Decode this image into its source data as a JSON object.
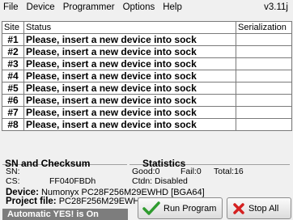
{
  "menu": {
    "items": [
      "File",
      "Device",
      "Programmer",
      "Options",
      "Help"
    ],
    "version": "v3.11j"
  },
  "table": {
    "headers": {
      "site": "Site",
      "status": "Status",
      "serialization": "Serialization"
    },
    "rows": [
      {
        "site": "#1",
        "status": "Please, insert a new device into sock",
        "serial": ""
      },
      {
        "site": "#2",
        "status": "Please, insert a new device into sock",
        "serial": ""
      },
      {
        "site": "#3",
        "status": "Please, insert a new device into sock",
        "serial": ""
      },
      {
        "site": "#4",
        "status": "Please, insert a new device into sock",
        "serial": ""
      },
      {
        "site": "#5",
        "status": "Please, insert a new device into sock",
        "serial": ""
      },
      {
        "site": "#6",
        "status": "Please, insert a new device into sock",
        "serial": ""
      },
      {
        "site": "#7",
        "status": "Please, insert a new device into sock",
        "serial": ""
      },
      {
        "site": "#8",
        "status": "Please, insert a new device into sock",
        "serial": ""
      }
    ]
  },
  "sn_checksum": {
    "title": "SN and Checksum",
    "sn_label": "SN:",
    "cs_label": "CS:",
    "cs_value": "FF040FBDh"
  },
  "statistics": {
    "title": "Statistics",
    "good": "Good:0",
    "fail": "Fail:0",
    "total": "Total:16",
    "ctdn": "Ctdn: Disabled"
  },
  "device": {
    "label": "Device:",
    "value": "Numonyx PC28F256M29EWHD [BGA64]"
  },
  "project": {
    "label": "Project file:",
    "value": "PC28F256M29EWHD.eprj"
  },
  "auto_status": "Automatic YES! is On",
  "buttons": {
    "run_program": "Run Program",
    "stop_all": "Stop All"
  },
  "colors": {
    "check_green": "#2e9b2e",
    "stop_red": "#d42020",
    "badge_gray": "#7d7d7d"
  }
}
